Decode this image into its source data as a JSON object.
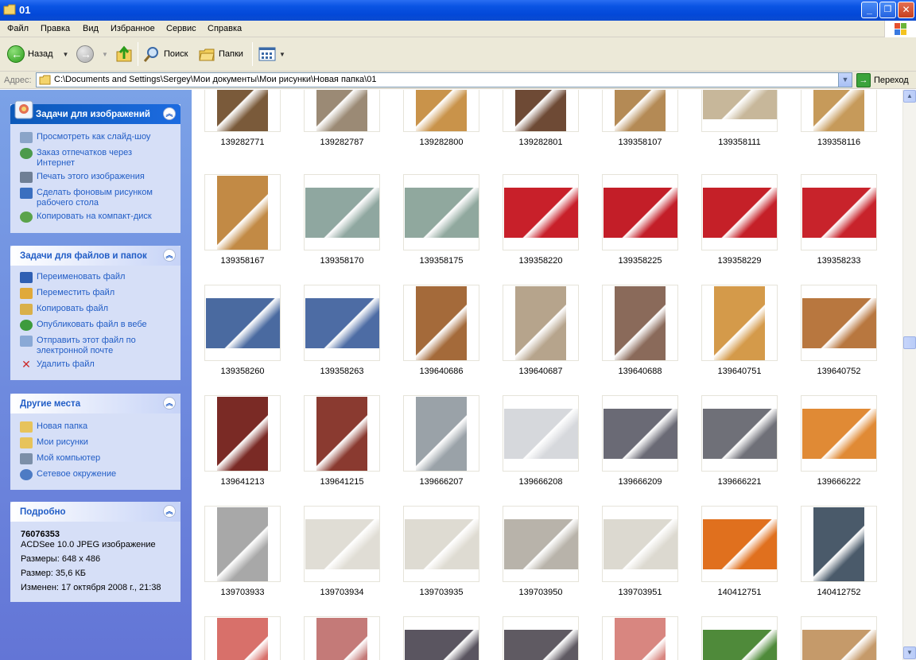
{
  "window": {
    "title": "01",
    "buttons": {
      "minimize": "_",
      "maximize": "❐",
      "close": "✕"
    }
  },
  "menu": [
    "Файл",
    "Правка",
    "Вид",
    "Избранное",
    "Сервис",
    "Справка"
  ],
  "toolbar": {
    "back": "Назад",
    "search": "Поиск",
    "folders": "Папки"
  },
  "address": {
    "label": "Адрес:",
    "path": "C:\\Documents and Settings\\Sergey\\Мои документы\\Мои рисунки\\Новая папка\\01",
    "go": "Переход"
  },
  "panels": {
    "image_tasks": {
      "title": "Задачи для изображений",
      "items": [
        {
          "label": "Просмотреть как слайд-шоу",
          "icon": "slideshow-icon",
          "color": "#8aa4c8"
        },
        {
          "label": "Заказ отпечатков через Интернет",
          "icon": "print-order-icon",
          "color": "#4c9a4c"
        },
        {
          "label": "Печать этого изображения",
          "icon": "printer-icon",
          "color": "#6f7f95"
        },
        {
          "label": "Сделать фоновым рисунком рабочего стола",
          "icon": "desktop-background-icon",
          "color": "#3b6fbf"
        },
        {
          "label": "Копировать на компакт-диск",
          "icon": "cd-copy-icon",
          "color": "#5ba34b"
        }
      ]
    },
    "file_tasks": {
      "title": "Задачи для файлов и папок",
      "items": [
        {
          "label": "Переименовать файл",
          "icon": "rename-icon",
          "color": "#2f5fb3"
        },
        {
          "label": "Переместить файл",
          "icon": "move-file-icon",
          "color": "#e0a93a"
        },
        {
          "label": "Копировать файл",
          "icon": "copy-file-icon",
          "color": "#d9b04a"
        },
        {
          "label": "Опубликовать файл в вебе",
          "icon": "publish-web-icon",
          "color": "#3d9b3d"
        },
        {
          "label": "Отправить этот файл по электронной почте",
          "icon": "email-icon",
          "color": "#8aa9d6"
        },
        {
          "label": "Удалить файл",
          "icon": "delete-icon",
          "color": "#cc2a2a"
        }
      ]
    },
    "other_places": {
      "title": "Другие места",
      "items": [
        {
          "label": "Новая папка",
          "icon": "folder-icon",
          "color": "#e7c35b"
        },
        {
          "label": "Мои рисунки",
          "icon": "my-pictures-icon",
          "color": "#e7c35b"
        },
        {
          "label": "Мой компьютер",
          "icon": "my-computer-icon",
          "color": "#7c8fa8"
        },
        {
          "label": "Сетевое окружение",
          "icon": "network-icon",
          "color": "#4d7bc4"
        }
      ]
    },
    "details": {
      "title": "Подробно",
      "name": "76076353",
      "type": "ACDSee 10.0 JPEG изображение",
      "dimensions": "Размеры: 648 x 486",
      "size": "Размер: 35,6 КБ",
      "modified": "Изменен: 17 октября 2008 г., 21:38"
    }
  },
  "thumbnails": [
    {
      "caption": "139282771",
      "orient": "p",
      "color": "#7a5a3a"
    },
    {
      "caption": "139282787",
      "orient": "p",
      "color": "#9b8a75"
    },
    {
      "caption": "139282800",
      "orient": "p",
      "color": "#c9934a"
    },
    {
      "caption": "139282801",
      "orient": "p",
      "color": "#6e4a35"
    },
    {
      "caption": "139358107",
      "orient": "p",
      "color": "#b48a55"
    },
    {
      "caption": "139358111",
      "orient": "l",
      "color": "#c7b79a"
    },
    {
      "caption": "139358116",
      "orient": "p",
      "color": "#c69a5a"
    },
    {
      "caption": "139358167",
      "orient": "p",
      "color": "#c28a45"
    },
    {
      "caption": "139358170",
      "orient": "l",
      "color": "#8fa7a0"
    },
    {
      "caption": "139358175",
      "orient": "l",
      "color": "#90a89e"
    },
    {
      "caption": "139358220",
      "orient": "l",
      "color": "#c8202a"
    },
    {
      "caption": "139358225",
      "orient": "l",
      "color": "#c31e28"
    },
    {
      "caption": "139358229",
      "orient": "l",
      "color": "#c52028"
    },
    {
      "caption": "139358233",
      "orient": "l",
      "color": "#c8232b"
    },
    {
      "caption": "139358260",
      "orient": "l",
      "color": "#4a6aa0"
    },
    {
      "caption": "139358263",
      "orient": "l",
      "color": "#4d6ca4"
    },
    {
      "caption": "139640686",
      "orient": "p",
      "color": "#a46a3a"
    },
    {
      "caption": "139640687",
      "orient": "p",
      "color": "#b6a48c"
    },
    {
      "caption": "139640688",
      "orient": "p",
      "color": "#8a6a5a"
    },
    {
      "caption": "139640751",
      "orient": "p",
      "color": "#d49a4a"
    },
    {
      "caption": "139640752",
      "orient": "l",
      "color": "#b8773f"
    },
    {
      "caption": "139641213",
      "orient": "p",
      "color": "#7a2a25"
    },
    {
      "caption": "139641215",
      "orient": "p",
      "color": "#8a3a30"
    },
    {
      "caption": "139666207",
      "orient": "p",
      "color": "#9aa2a8"
    },
    {
      "caption": "139666208",
      "orient": "l",
      "color": "#d6d8dc"
    },
    {
      "caption": "139666209",
      "orient": "l",
      "color": "#6a6a75"
    },
    {
      "caption": "139666221",
      "orient": "l",
      "color": "#6f7078"
    },
    {
      "caption": "139666222",
      "orient": "l",
      "color": "#e08a35"
    },
    {
      "caption": "139703933",
      "orient": "p",
      "color": "#a8a8a8"
    },
    {
      "caption": "139703934",
      "orient": "l",
      "color": "#e0ddd5"
    },
    {
      "caption": "139703935",
      "orient": "l",
      "color": "#dedbd2"
    },
    {
      "caption": "139703950",
      "orient": "l",
      "color": "#b8b3aa"
    },
    {
      "caption": "139703951",
      "orient": "l",
      "color": "#dcd9d0"
    },
    {
      "caption": "140412751",
      "orient": "l",
      "color": "#e0701e"
    },
    {
      "caption": "140412752",
      "orient": "p",
      "color": "#4a5a6a"
    },
    {
      "caption": "",
      "orient": "p",
      "color": "#d8706a"
    },
    {
      "caption": "",
      "orient": "p",
      "color": "#c47a78"
    },
    {
      "caption": "",
      "orient": "l",
      "color": "#5a5560"
    },
    {
      "caption": "",
      "orient": "l",
      "color": "#5f5a62"
    },
    {
      "caption": "",
      "orient": "p",
      "color": "#d88680"
    },
    {
      "caption": "",
      "orient": "l",
      "color": "#4f8a3a"
    },
    {
      "caption": "",
      "orient": "l",
      "color": "#c59a6a"
    }
  ]
}
